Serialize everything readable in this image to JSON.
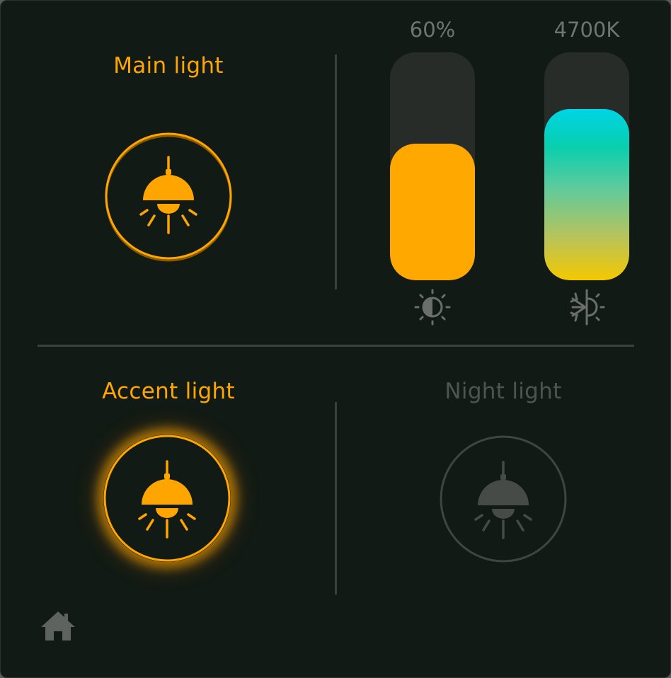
{
  "lights": {
    "main": {
      "label": "Main light",
      "state": "on"
    },
    "accent": {
      "label": "Accent light",
      "state": "on"
    },
    "night": {
      "label": "Night light",
      "state": "off"
    }
  },
  "brightness": {
    "value_text": "60%",
    "level": 0.6,
    "icon": "contrast-sun-icon"
  },
  "temperature": {
    "value_text": "4700K",
    "level": 0.75,
    "icon": "snowflake-sun-icon"
  },
  "icons": {
    "lamp": "pendant-lamp-icon",
    "home": "home-icon"
  },
  "colors": {
    "accent": "#ffa500",
    "background": "#111a14",
    "off": "#4e5450",
    "track": "#272c29"
  }
}
